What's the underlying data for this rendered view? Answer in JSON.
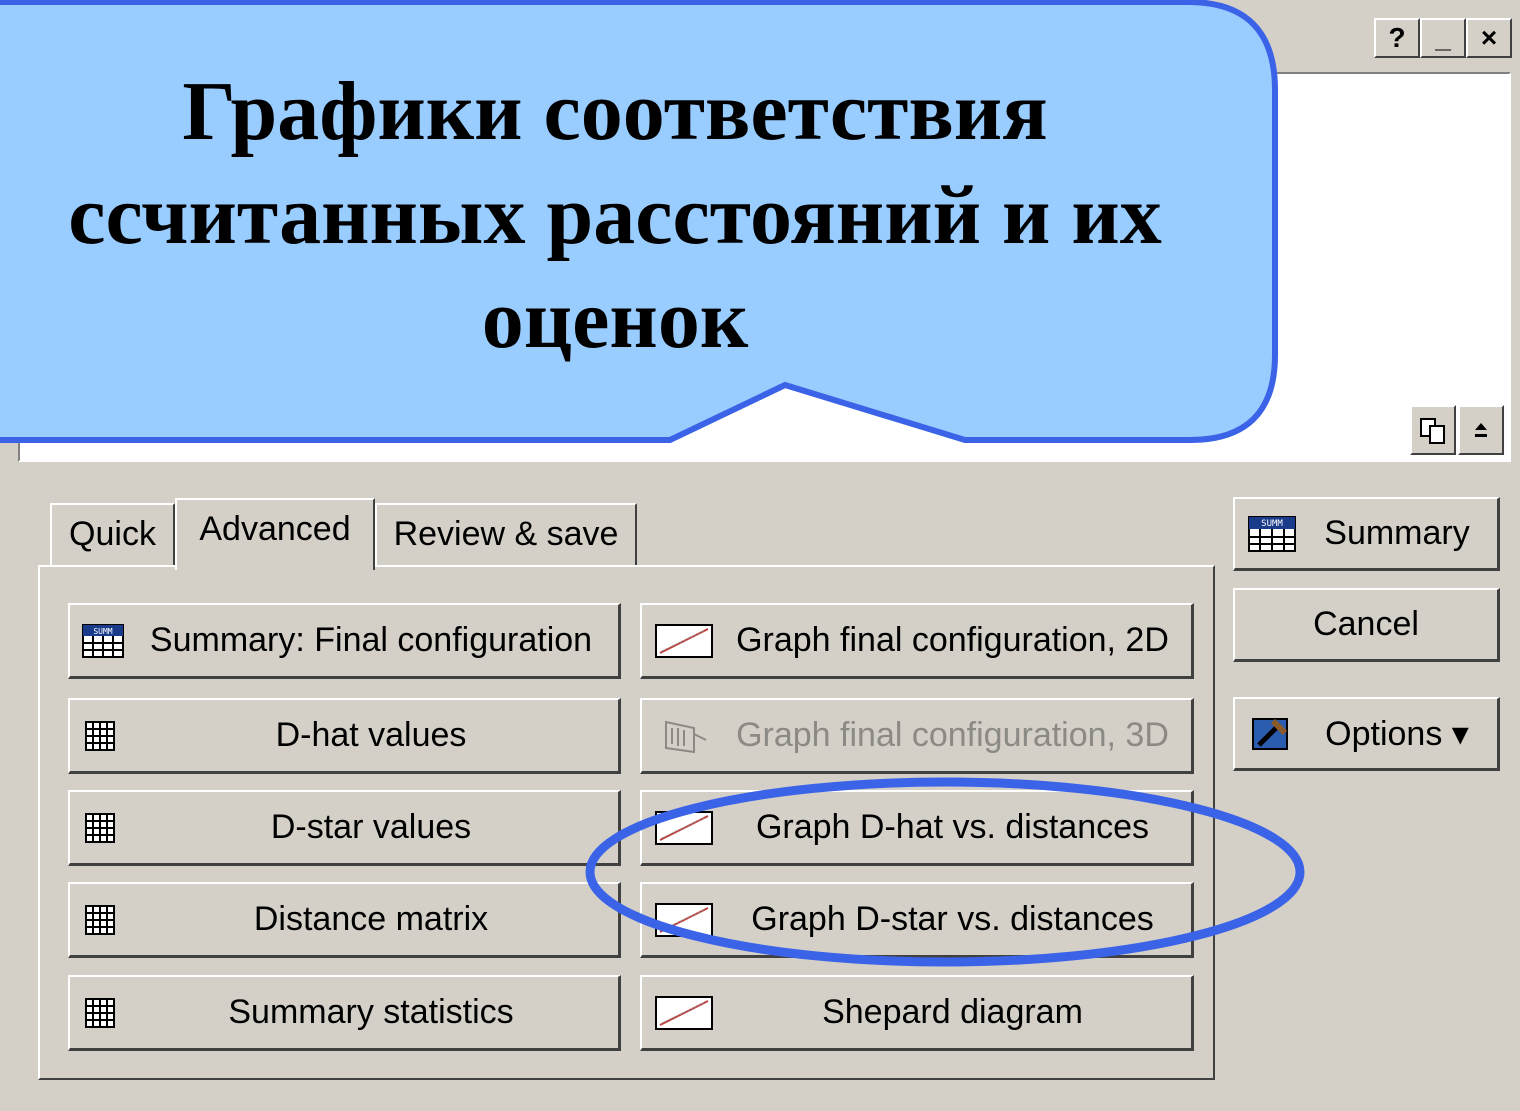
{
  "titlebar": {
    "help": "?",
    "minimize": "_",
    "close": "×"
  },
  "callout": {
    "lines": [
      "Графики соответствия",
      "ссчитанных расстояний и их",
      "оценок"
    ]
  },
  "tabs": [
    {
      "label": "Quick"
    },
    {
      "label": "Advanced"
    },
    {
      "label": "Review & save"
    }
  ],
  "buttons": {
    "summary_final": "Summary: Final configuration",
    "dhat_values": "D-hat values",
    "dstar_values": "D-star values",
    "distance_matrix": "Distance matrix",
    "summary_statistics": "Summary statistics",
    "graph_final_2d": "Graph final configuration, 2D",
    "graph_final_3d": "Graph final configuration, 3D",
    "graph_dhat": "Graph D-hat vs. distances",
    "graph_dstar": "Graph D-star vs. distances",
    "shepard": "Shepard diagram"
  },
  "side": {
    "summary": "Summary",
    "cancel": "Cancel",
    "options": "Options ▾"
  },
  "colors": {
    "callout_fill": "#99ccff",
    "callout_border": "#3b63e8",
    "highlight_ellipse": "#3b63e8"
  },
  "icons": [
    "summary-table-icon",
    "grid-table-icon",
    "scatter-graph-icon",
    "3d-graph-icon",
    "options-hammer-icon",
    "copy-icon",
    "maximize-icon"
  ]
}
